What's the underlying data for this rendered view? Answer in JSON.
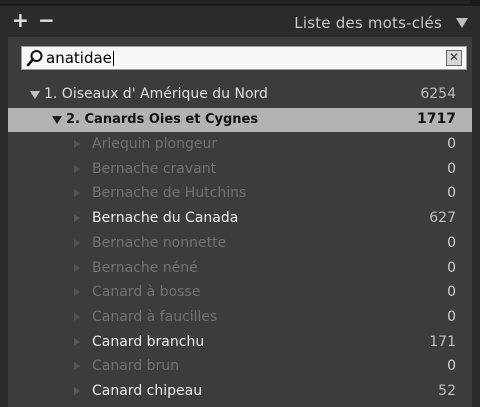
{
  "panel": {
    "title": "Liste des mots-clés",
    "add_symbol": "+",
    "remove_symbol": "−"
  },
  "search": {
    "value": "anatidae",
    "clear_symbol": "✕"
  },
  "tree": {
    "root": {
      "label": "1. Oiseaux d' Amérique du Nord",
      "count": "6254"
    },
    "group": {
      "label": "2. Canards  Oies et Cygnes",
      "count": "1717"
    },
    "items": [
      {
        "label": "Arlequin plongeur",
        "count": "0"
      },
      {
        "label": "Bernache cravant",
        "count": "0"
      },
      {
        "label": "Bernache de Hutchins",
        "count": "0"
      },
      {
        "label": "Bernache du Canada",
        "count": "627"
      },
      {
        "label": "Bernache nonnette",
        "count": "0"
      },
      {
        "label": "Bernache néné",
        "count": "0"
      },
      {
        "label": "Canard à bosse",
        "count": "0"
      },
      {
        "label": "Canard à faucilles",
        "count": "0"
      },
      {
        "label": "Canard branchu",
        "count": "171"
      },
      {
        "label": "Canard brun",
        "count": "0"
      },
      {
        "label": "Canard chipeau",
        "count": "52"
      }
    ]
  }
}
